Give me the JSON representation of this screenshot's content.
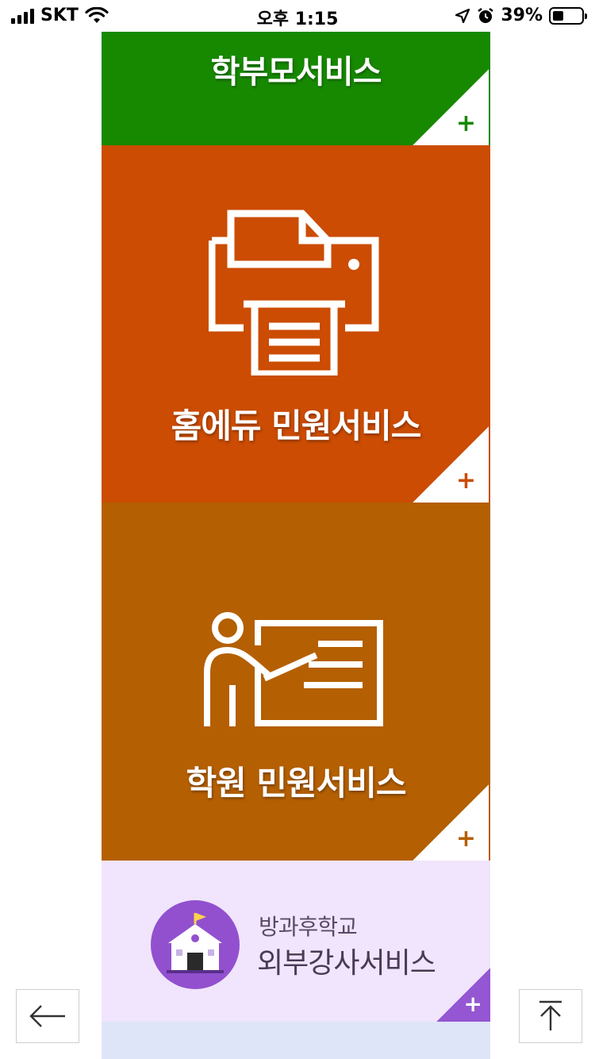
{
  "status_bar": {
    "carrier": "SKT",
    "time": "오후 1:15",
    "battery_percent": "39%",
    "battery_level": 0.39,
    "icons": [
      "signal-icon",
      "wifi-icon",
      "location-icon",
      "alarm-icon",
      "battery-icon"
    ]
  },
  "tiles": {
    "parent": {
      "title": "학부모서비스",
      "color": "#178900",
      "plus": "+"
    },
    "homeedu": {
      "title": "홈에듀 민원서비스",
      "color": "#cb4c02",
      "icon": "printer-icon",
      "plus": "+"
    },
    "academy": {
      "title": "학원 민원서비스",
      "color": "#b45f02",
      "icon": "teacher-board-icon",
      "plus": "+"
    },
    "afterschool": {
      "subtitle": "방과후학교",
      "title": "외부강사서비스",
      "color": "#f0e5fc",
      "accent": "#9250cf",
      "icon": "school-icon",
      "plus": "+"
    }
  },
  "buttons": {
    "back_icon": "arrow-left-icon",
    "top_icon": "arrow-to-top-icon"
  }
}
